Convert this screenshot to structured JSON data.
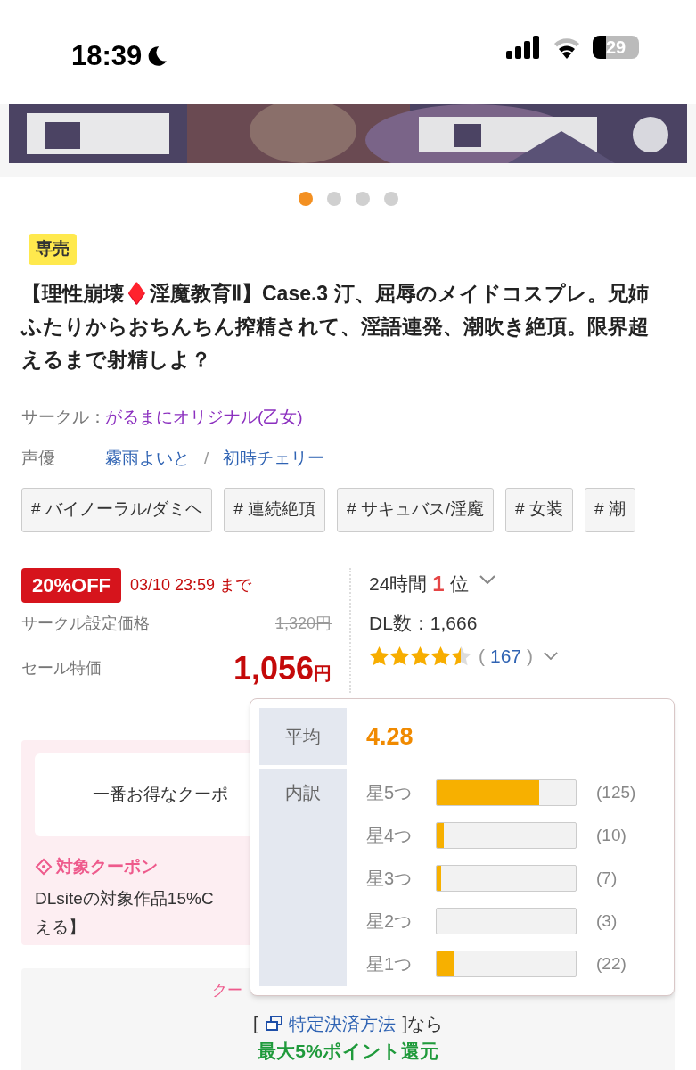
{
  "status_bar": {
    "time": "18:39",
    "battery": "29"
  },
  "carousel": {
    "pages": [
      {
        "selected": true
      },
      {
        "selected": false
      },
      {
        "selected": false
      },
      {
        "selected": false
      }
    ]
  },
  "badge": "専売",
  "title": "【理性崩壊♦️淫魔教育Ⅱ】Case.3 汀、屈辱のメイドコスプレ。兄姉ふたりからおちんちん搾精されて、淫語連発、潮吹き絶頂。限界超えるまで射精しよ？",
  "circle": {
    "label": "サークル：",
    "value": "がるまにオリジナル(乙女)"
  },
  "voice": {
    "label": "声優",
    "separator": "/",
    "names": [
      "霧雨よいと",
      "初時チェリー"
    ]
  },
  "tags": [
    "# バイノーラル/ダミヘ",
    "# 連続絶頂",
    "# サキュバス/淫魔",
    "# 女装",
    "# 潮"
  ],
  "sale": {
    "discount": "20%OFF",
    "deadline": "03/10 23:59 まで",
    "list_label": "サークル設定価格",
    "list_price": "1,320円",
    "sale_label": "セール特価",
    "sale_price": "1,056",
    "currency": "円"
  },
  "ranking": {
    "prefix": "24時間",
    "rank": "1",
    "suffix": "位"
  },
  "downloads": "DL数：1,666",
  "rating": {
    "stars": 4.5,
    "open": "(",
    "count": "167",
    "close": ")"
  },
  "rating_popup": {
    "average_label": "平均",
    "average": "4.28",
    "breakdown_label": "内訳",
    "rows": [
      {
        "label": "星5つ",
        "level": 0.74,
        "count": "(125)"
      },
      {
        "label": "星4つ",
        "level": 0.05,
        "count": "(10)"
      },
      {
        "label": "星3つ",
        "level": 0.03,
        "count": "(7)"
      },
      {
        "label": "星2つ",
        "level": 0,
        "count": "(3)"
      },
      {
        "label": "星1つ",
        "level": 0.12,
        "count": "(22)"
      }
    ]
  },
  "coupon": {
    "button": "一番お得なクーポ",
    "heading": "対象クーポン",
    "text_line_1": "DLsiteの対象作品15%C",
    "text_line_2": "える】"
  },
  "payment": {
    "coupon_note": "クー",
    "open_bracket": "[",
    "link": "特定決済方法",
    "close": "]なら",
    "reward": "最大5%ポイント還元"
  }
}
